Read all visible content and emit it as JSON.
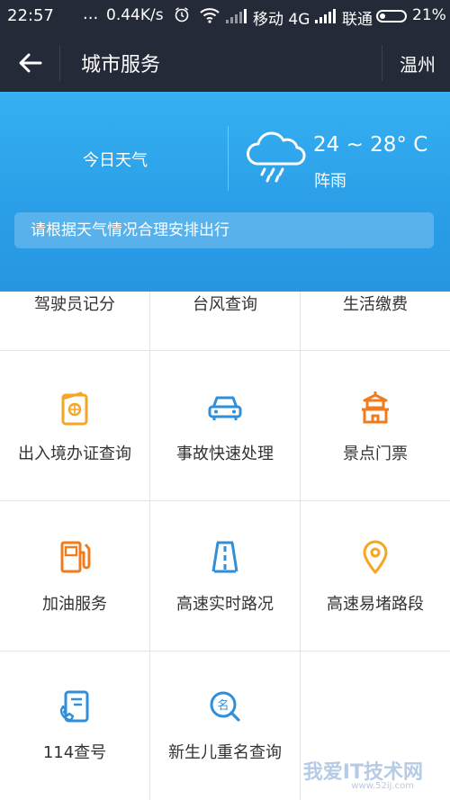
{
  "status_bar": {
    "time": "22:57",
    "dots": "...",
    "speed": "0.44K/s",
    "carrier1": "移动 4G",
    "carrier2": "联通",
    "battery": "21%"
  },
  "header": {
    "title": "城市服务",
    "city": "温州",
    "icons": {
      "back": "arrow-left-icon"
    }
  },
  "weather": {
    "label": "今日天气",
    "temperature": "24 ~ 28° C",
    "condition": "阵雨",
    "notice": "请根据天气情况合理安排出行",
    "icon": "cloud-rain-icon"
  },
  "services": {
    "row0": [
      "驾驶员记分",
      "台风查询",
      "生活缴费"
    ],
    "row1": [
      {
        "label": "出入境办证查询",
        "icon": "passport-icon",
        "color": "#f5a623"
      },
      {
        "label": "事故快速处理",
        "icon": "car-icon",
        "color": "#2f8fd8"
      },
      {
        "label": "景点门票",
        "icon": "pagoda-icon",
        "color": "#f07c1e"
      }
    ],
    "row2": [
      {
        "label": "加油服务",
        "icon": "gas-pump-icon",
        "color": "#f07c1e"
      },
      {
        "label": "高速实时路况",
        "icon": "highway-icon",
        "color": "#2f8fd8"
      },
      {
        "label": "高速易堵路段",
        "icon": "location-pin-icon",
        "color": "#f5a623"
      }
    ],
    "row3": [
      {
        "label": "114查号",
        "icon": "phone-book-icon",
        "color": "#2f8fd8"
      },
      {
        "label": "新生儿重名查询",
        "icon": "name-search-icon",
        "color": "#2f8fd8"
      }
    ]
  },
  "watermark": {
    "text": "我爱IT技术网",
    "sub": "www.52ij.com"
  }
}
